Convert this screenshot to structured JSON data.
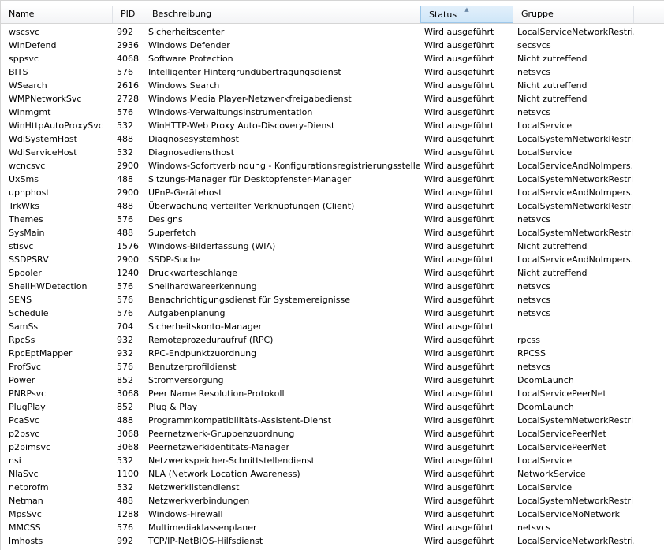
{
  "columns": [
    "Name",
    "PID",
    "Beschreibung",
    "Status",
    "Gruppe"
  ],
  "rows": [
    [
      "wscsvc",
      "992",
      "Sicherheitscenter",
      "Wird ausgeführt",
      "LocalServiceNetworkRestri..."
    ],
    [
      "WinDefend",
      "2936",
      "Windows Defender",
      "Wird ausgeführt",
      "secsvcs"
    ],
    [
      "sppsvc",
      "4068",
      "Software Protection",
      "Wird ausgeführt",
      "Nicht zutreffend"
    ],
    [
      "BITS",
      "576",
      "Intelligenter Hintergrundübertragungsdienst",
      "Wird ausgeführt",
      "netsvcs"
    ],
    [
      "WSearch",
      "2616",
      "Windows Search",
      "Wird ausgeführt",
      "Nicht zutreffend"
    ],
    [
      "WMPNetworkSvc",
      "2728",
      "Windows Media Player-Netzwerkfreigabedienst",
      "Wird ausgeführt",
      "Nicht zutreffend"
    ],
    [
      "Winmgmt",
      "576",
      "Windows-Verwaltungsinstrumentation",
      "Wird ausgeführt",
      "netsvcs"
    ],
    [
      "WinHttpAutoProxySvc",
      "532",
      "WinHTTP-Web Proxy Auto-Discovery-Dienst",
      "Wird ausgeführt",
      "LocalService"
    ],
    [
      "WdiSystemHost",
      "488",
      "Diagnosesystemhost",
      "Wird ausgeführt",
      "LocalSystemNetworkRestri..."
    ],
    [
      "WdiServiceHost",
      "532",
      "Diagnosediensthost",
      "Wird ausgeführt",
      "LocalService"
    ],
    [
      "wcncsvc",
      "2900",
      "Windows-Sofortverbindung - Konfigurationsregistrierungsstelle",
      "Wird ausgeführt",
      "LocalServiceAndNoImpers..."
    ],
    [
      "UxSms",
      "488",
      "Sitzungs-Manager für Desktopfenster-Manager",
      "Wird ausgeführt",
      "LocalSystemNetworkRestri..."
    ],
    [
      "upnphost",
      "2900",
      "UPnP-Gerätehost",
      "Wird ausgeführt",
      "LocalServiceAndNoImpers..."
    ],
    [
      "TrkWks",
      "488",
      "Überwachung verteilter Verknüpfungen (Client)",
      "Wird ausgeführt",
      "LocalSystemNetworkRestri..."
    ],
    [
      "Themes",
      "576",
      "Designs",
      "Wird ausgeführt",
      "netsvcs"
    ],
    [
      "SysMain",
      "488",
      "Superfetch",
      "Wird ausgeführt",
      "LocalSystemNetworkRestri..."
    ],
    [
      "stisvc",
      "1576",
      "Windows-Bilderfassung (WIA)",
      "Wird ausgeführt",
      "Nicht zutreffend"
    ],
    [
      "SSDPSRV",
      "2900",
      "SSDP-Suche",
      "Wird ausgeführt",
      "LocalServiceAndNoImpers..."
    ],
    [
      "Spooler",
      "1240",
      "Druckwarteschlange",
      "Wird ausgeführt",
      "Nicht zutreffend"
    ],
    [
      "ShellHWDetection",
      "576",
      "Shellhardwareerkennung",
      "Wird ausgeführt",
      "netsvcs"
    ],
    [
      "SENS",
      "576",
      "Benachrichtigungsdienst für Systemereignisse",
      "Wird ausgeführt",
      "netsvcs"
    ],
    [
      "Schedule",
      "576",
      "Aufgabenplanung",
      "Wird ausgeführt",
      "netsvcs"
    ],
    [
      "SamSs",
      "704",
      "Sicherheitskonto-Manager",
      "Wird ausgeführt",
      ""
    ],
    [
      "RpcSs",
      "932",
      "Remoteprozeduraufruf (RPC)",
      "Wird ausgeführt",
      "rpcss"
    ],
    [
      "RpcEptMapper",
      "932",
      "RPC-Endpunktzuordnung",
      "Wird ausgeführt",
      "RPCSS"
    ],
    [
      "ProfSvc",
      "576",
      "Benutzerprofildienst",
      "Wird ausgeführt",
      "netsvcs"
    ],
    [
      "Power",
      "852",
      "Stromversorgung",
      "Wird ausgeführt",
      "DcomLaunch"
    ],
    [
      "PNRPsvc",
      "3068",
      "Peer Name Resolution-Protokoll",
      "Wird ausgeführt",
      "LocalServicePeerNet"
    ],
    [
      "PlugPlay",
      "852",
      "Plug & Play",
      "Wird ausgeführt",
      "DcomLaunch"
    ],
    [
      "PcaSvc",
      "488",
      "Programmkompatibilitäts-Assistent-Dienst",
      "Wird ausgeführt",
      "LocalSystemNetworkRestri..."
    ],
    [
      "p2psvc",
      "3068",
      "Peernetzwerk-Gruppenzuordnung",
      "Wird ausgeführt",
      "LocalServicePeerNet"
    ],
    [
      "p2pimsvc",
      "3068",
      "Peernetzwerkidentitäts-Manager",
      "Wird ausgeführt",
      "LocalServicePeerNet"
    ],
    [
      "nsi",
      "532",
      "Netzwerkspeicher-Schnittstellendienst",
      "Wird ausgeführt",
      "LocalService"
    ],
    [
      "NlaSvc",
      "1100",
      "NLA (Network Location Awareness)",
      "Wird ausgeführt",
      "NetworkService"
    ],
    [
      "netprofm",
      "532",
      "Netzwerklistendienst",
      "Wird ausgeführt",
      "LocalService"
    ],
    [
      "Netman",
      "488",
      "Netzwerkverbindungen",
      "Wird ausgeführt",
      "LocalSystemNetworkRestri..."
    ],
    [
      "MpsSvc",
      "1288",
      "Windows-Firewall",
      "Wird ausgeführt",
      "LocalServiceNoNetwork"
    ],
    [
      "MMCSS",
      "576",
      "Multimediaklassenplaner",
      "Wird ausgeführt",
      "netsvcs"
    ],
    [
      "lmhosts",
      "992",
      "TCP/IP-NetBIOS-Hilfsdienst",
      "Wird ausgeführt",
      "LocalServiceNetworkRestri..."
    ]
  ]
}
